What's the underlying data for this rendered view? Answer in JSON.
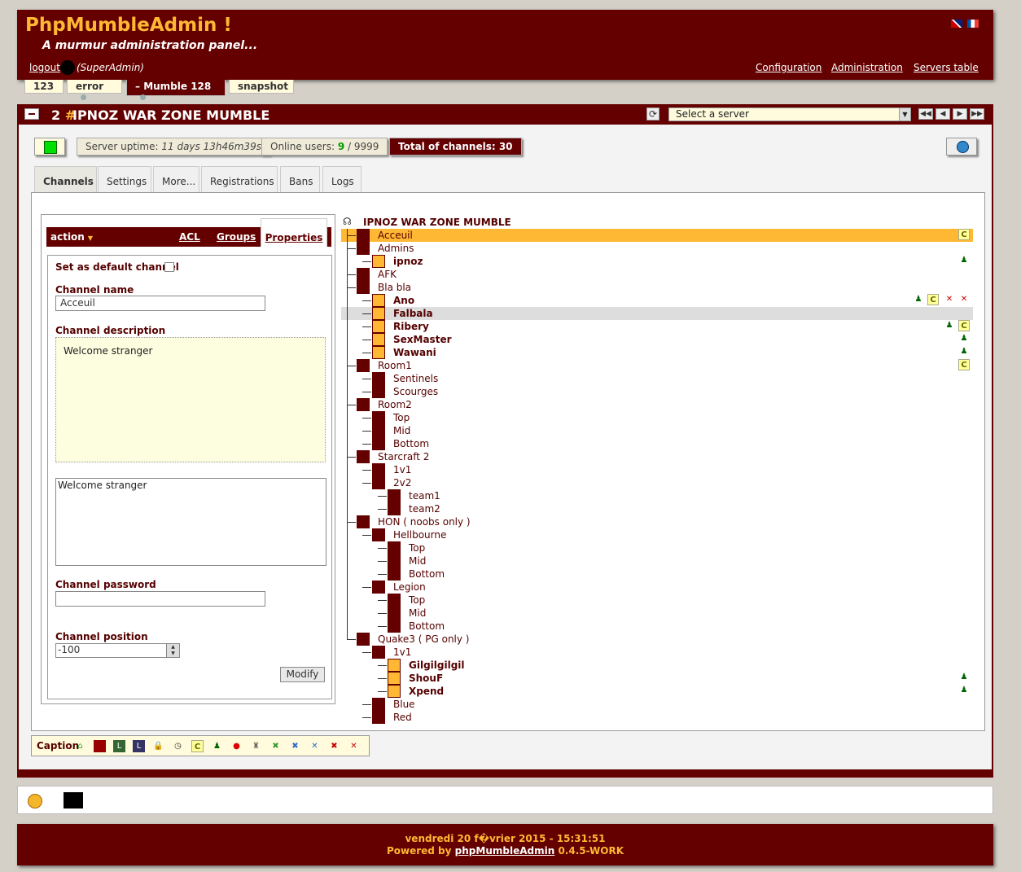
{
  "header": {
    "title": "PhpMumbleAdmin !",
    "subtitle": "A murmur administration panel...",
    "logout": "logout",
    "role": "(SuperAdmin)",
    "nav": {
      "config": "Configuration",
      "admin": "Administration",
      "servers": "Servers table"
    }
  },
  "top_tabs": [
    {
      "label": "123"
    },
    {
      "label": "error"
    },
    {
      "label": "Mumble 128"
    },
    {
      "label": "snapshot"
    }
  ],
  "server": {
    "id": "2",
    "hash": "#",
    "name": "IPNOZ WAR ZONE MUMBLE",
    "select_placeholder": "Select a server"
  },
  "status": {
    "uptime_label": "Server uptime:",
    "uptime_value": "11 days 13h46m39s",
    "users_label": "Online users:",
    "users_online": "9",
    "users_max": "/ 9999",
    "channels_label": "Total of channels: 30"
  },
  "main_tabs": [
    "Channels",
    "Settings",
    "More...",
    "Registrations",
    "Bans",
    "Logs"
  ],
  "panel": {
    "action": "action",
    "acl": "ACL",
    "groups": "Groups",
    "properties": "Properties",
    "default_label": "Set as default channel",
    "name_label": "Channel name",
    "name_value": "Acceuil",
    "desc_label": "Channel description",
    "desc_value": "Welcome stranger",
    "desc_text": "Welcome stranger",
    "pwd_label": "Channel password",
    "pos_label": "Channel position",
    "pos_value": "-100",
    "modify": "Modify"
  },
  "tree": {
    "root": "IPNOZ WAR ZONE MUMBLE",
    "nodes": [
      {
        "label": "Acceuil",
        "kind": "channel",
        "depth": 0,
        "state": "selected"
      },
      {
        "label": "Admins",
        "kind": "channel",
        "depth": 0
      },
      {
        "label": "ipnoz",
        "kind": "user",
        "depth": 1
      },
      {
        "label": "AFK",
        "kind": "channel",
        "depth": 0
      },
      {
        "label": "Bla bla",
        "kind": "channel",
        "depth": 0
      },
      {
        "label": "Ano",
        "kind": "user",
        "depth": 1
      },
      {
        "label": "Falbala",
        "kind": "user",
        "depth": 1,
        "state": "highlight"
      },
      {
        "label": "Ribery",
        "kind": "user",
        "depth": 1
      },
      {
        "label": "SexMaster",
        "kind": "user",
        "depth": 1
      },
      {
        "label": "Wawani",
        "kind": "user",
        "depth": 1
      },
      {
        "label": "Room1",
        "kind": "channel",
        "depth": 0
      },
      {
        "label": "Sentinels",
        "kind": "channel",
        "depth": 1
      },
      {
        "label": "Scourges",
        "kind": "channel",
        "depth": 1
      },
      {
        "label": "Room2",
        "kind": "channel",
        "depth": 0
      },
      {
        "label": "Top",
        "kind": "channel",
        "depth": 1
      },
      {
        "label": "Mid",
        "kind": "channel",
        "depth": 1
      },
      {
        "label": "Bottom",
        "kind": "channel",
        "depth": 1
      },
      {
        "label": "Starcraft 2",
        "kind": "channel",
        "depth": 0
      },
      {
        "label": "1v1",
        "kind": "channel",
        "depth": 1
      },
      {
        "label": "2v2",
        "kind": "channel",
        "depth": 1
      },
      {
        "label": "team1",
        "kind": "channel",
        "depth": 2
      },
      {
        "label": "team2",
        "kind": "channel",
        "depth": 2
      },
      {
        "label": "HON ( noobs only )",
        "kind": "channel",
        "depth": 0
      },
      {
        "label": "Hellbourne",
        "kind": "channel",
        "depth": 1
      },
      {
        "label": "Top",
        "kind": "channel",
        "depth": 2
      },
      {
        "label": "Mid",
        "kind": "channel",
        "depth": 2
      },
      {
        "label": "Bottom",
        "kind": "channel",
        "depth": 2
      },
      {
        "label": "Legion",
        "kind": "channel",
        "depth": 1
      },
      {
        "label": "Top",
        "kind": "channel",
        "depth": 2
      },
      {
        "label": "Mid",
        "kind": "channel",
        "depth": 2
      },
      {
        "label": "Bottom",
        "kind": "channel",
        "depth": 2
      },
      {
        "label": "Quake3 ( PG only )",
        "kind": "channel",
        "depth": 0
      },
      {
        "label": "1v1",
        "kind": "channel",
        "depth": 1
      },
      {
        "label": "Gilgilgilgil",
        "kind": "user",
        "depth": 2
      },
      {
        "label": "ShouF",
        "kind": "user",
        "depth": 2
      },
      {
        "label": "Xpend",
        "kind": "user",
        "depth": 2
      },
      {
        "label": "Blue",
        "kind": "channel",
        "depth": 1
      },
      {
        "label": "Red",
        "kind": "channel",
        "depth": 1
      }
    ]
  },
  "caption": "Caption",
  "footer": {
    "date": "vendredi 20 f�vrier 2015 - 15:31:51",
    "powered_prefix": "Powered by",
    "powered_link": "phpMumbleAdmin",
    "version": "0.4.5-WORK"
  },
  "colors": {
    "brand": "#640000",
    "accent": "#ffb833"
  },
  "icons": [
    "uk-flag-icon",
    "fr-flag-icon",
    "refresh-icon",
    "globe-icon",
    "user-add-icon",
    "comment-icon",
    "mute-icon",
    "deaf-icon",
    "smiley-icon"
  ]
}
